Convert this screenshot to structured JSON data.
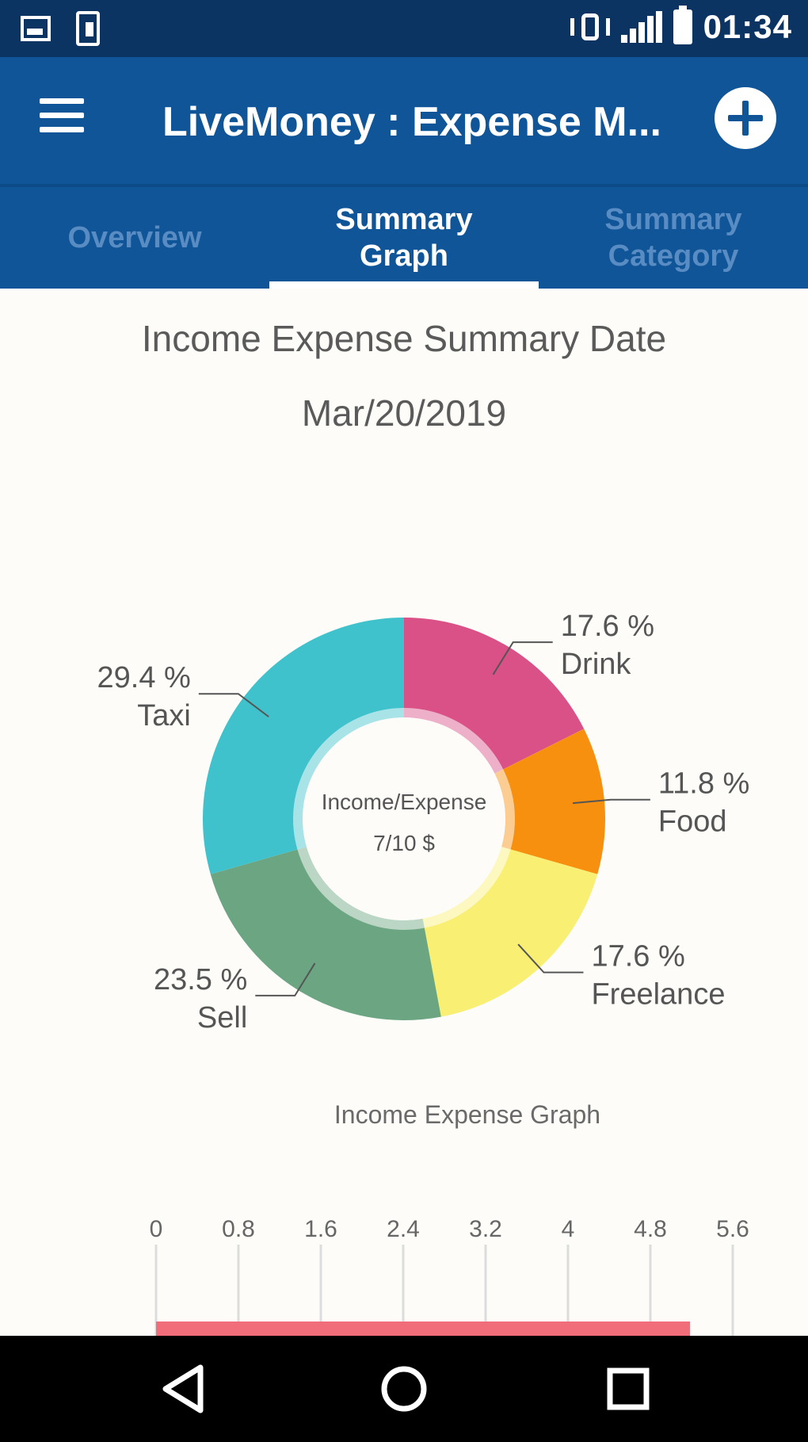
{
  "status_bar": {
    "time": "01:34",
    "icons": [
      "image-notification-icon",
      "sim-card-icon",
      "vibrate-icon",
      "signal-icon",
      "battery-icon"
    ]
  },
  "app_bar": {
    "title": "LiveMoney : Expense M...",
    "menu_icon": "hamburger-menu-icon",
    "add_icon": "add-circle-icon"
  },
  "tabs": [
    {
      "label_line1": "Overview",
      "label_line2": "",
      "active": false
    },
    {
      "label_line1": "Summary",
      "label_line2": "Graph",
      "active": true
    },
    {
      "label_line1": "Summary",
      "label_line2": "Category",
      "active": false
    }
  ],
  "summary": {
    "title_line1": "Income Expense Summary Date",
    "title_line2": "Mar/20/2019"
  },
  "colors": {
    "app_bar": "#0f5597",
    "status_bar": "#0c3463",
    "tab_active": "#ffffff",
    "tab_inactive": "#5a8cc4",
    "background": "#fdfcf8",
    "bar": "#f26d7a"
  },
  "chart_data": [
    {
      "type": "pie",
      "center_label_line1": "Income/Expense",
      "center_label_line2": "7/10 $",
      "slices": [
        {
          "label": "Drink",
          "percent": 17.6,
          "percent_text": "17.6 %",
          "color": "#d95187"
        },
        {
          "label": "Food",
          "percent": 11.8,
          "percent_text": "11.8 %",
          "color": "#f7900f"
        },
        {
          "label": "Freelance",
          "percent": 17.6,
          "percent_text": "17.6 %",
          "color": "#f8ef73"
        },
        {
          "label": "Sell",
          "percent": 23.5,
          "percent_text": "23.5 %",
          "color": "#6ba582"
        },
        {
          "label": "Taxi",
          "percent": 29.4,
          "percent_text": "29.4 %",
          "color": "#3fc2cb"
        }
      ]
    },
    {
      "type": "bar",
      "title": "Income Expense Graph",
      "x_ticks": [
        "0",
        "0.8",
        "1.6",
        "2.4",
        "3.2",
        "4",
        "4.8",
        "5.6"
      ],
      "xlim": [
        0,
        5.6
      ],
      "bar_values": [
        4.8
      ]
    }
  ]
}
